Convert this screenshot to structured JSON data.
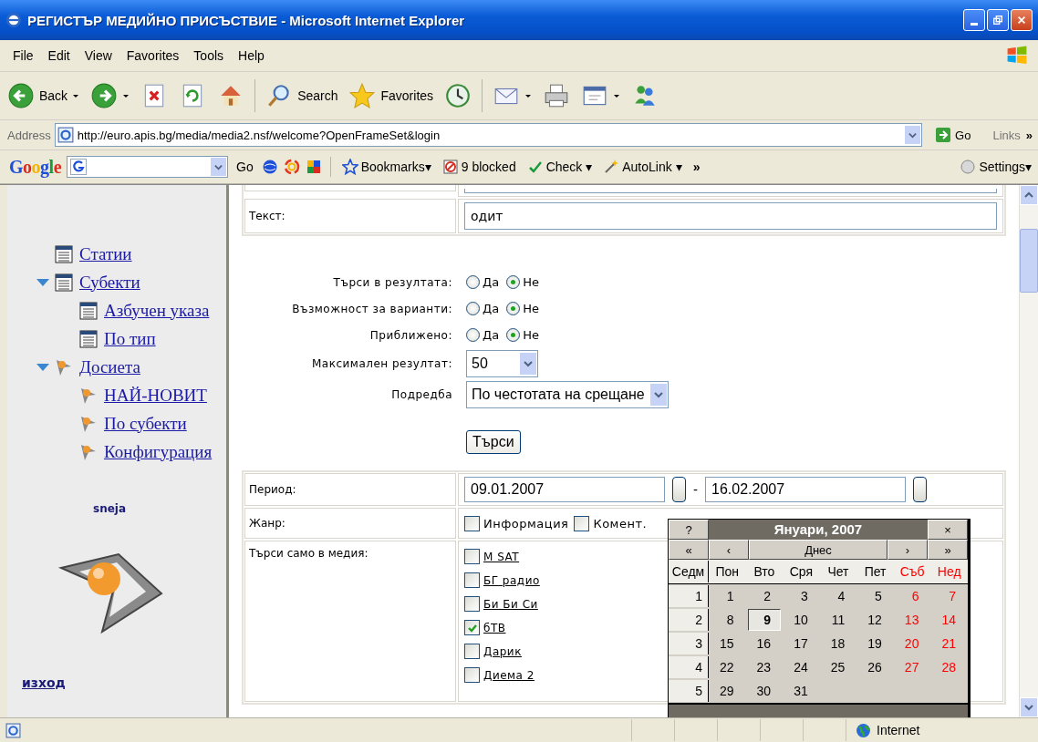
{
  "window": {
    "title": "РЕГИСТЪР МЕДИЙНО ПРИСЪСТВИЕ - Microsoft Internet Explorer"
  },
  "menu": [
    "File",
    "Edit",
    "View",
    "Favorites",
    "Tools",
    "Help"
  ],
  "toolbar": [
    {
      "kind": "back",
      "label": "Back",
      "dropdown": true
    },
    {
      "kind": "forward",
      "dropdown": true
    },
    {
      "kind": "stop"
    },
    {
      "kind": "refresh"
    },
    {
      "kind": "home"
    },
    {
      "kind": "sep"
    },
    {
      "kind": "search",
      "label": "Search"
    },
    {
      "kind": "favorites",
      "label": "Favorites"
    },
    {
      "kind": "history"
    },
    {
      "kind": "sep"
    },
    {
      "kind": "mail",
      "dropdown": true
    },
    {
      "kind": "print"
    },
    {
      "kind": "edit",
      "dropdown": true
    },
    {
      "kind": "messenger"
    }
  ],
  "address": {
    "label": "Address",
    "url": "http://euro.apis.bg/media/media2.nsf/welcome?OpenFrameSet&login",
    "go": "Go",
    "links": "Links",
    "more": "»"
  },
  "google_bar": {
    "logo": "Google",
    "go": "Go",
    "items": [
      {
        "kind": "bookmarks",
        "label": "Bookmarks▾"
      },
      {
        "kind": "blocked",
        "label": "9 blocked"
      },
      {
        "kind": "check",
        "label": "Check ▾"
      },
      {
        "kind": "autolink",
        "label": "AutoLink ▾"
      },
      {
        "kind": "more",
        "label": "»"
      }
    ],
    "settings": "Settings▾"
  },
  "sidebar": {
    "tree": [
      {
        "label": "Статии",
        "kind": "list"
      },
      {
        "label": "Субекти",
        "kind": "list",
        "expanded": true,
        "children": [
          {
            "label": "Азбучен указа",
            "kind": "list"
          },
          {
            "label": "По тип",
            "kind": "list"
          }
        ]
      },
      {
        "label": "Досиета",
        "kind": "dossier",
        "expanded": true,
        "children": [
          {
            "label": "НАЙ-НОВИТ",
            "kind": "dossier"
          },
          {
            "label": "По субекти",
            "kind": "dossier"
          },
          {
            "label": "Конфигурация",
            "kind": "dossier"
          }
        ]
      }
    ],
    "user": "sneja",
    "logout": "изход"
  },
  "form": {
    "text_field": {
      "label": "Текст:",
      "value": "одит"
    },
    "options": [
      {
        "label": "Търси в резултата:",
        "choices": [
          {
            "label": "Да",
            "selected": false
          },
          {
            "label": "Не",
            "selected": true
          }
        ]
      },
      {
        "label": "Възможност за варианти:",
        "choices": [
          {
            "label": "Да",
            "selected": false
          },
          {
            "label": "Не",
            "selected": true
          }
        ]
      },
      {
        "label": "Приближено:",
        "choices": [
          {
            "label": "Да",
            "selected": false
          },
          {
            "label": "Не",
            "selected": true
          }
        ]
      }
    ],
    "max_results": {
      "label": "Максимален резултат:",
      "value": "50"
    },
    "order": {
      "label": "Подредба",
      "value": "По честотата на срещане"
    },
    "submit": "Търси",
    "period": {
      "label": "Период:",
      "from": "09.01.2007",
      "separator": "-",
      "to": "16.02.2007"
    },
    "genre": {
      "label": "Жанр:",
      "options": [
        {
          "label": "Информация",
          "checked": false
        },
        {
          "label": "Комент.",
          "checked": false
        }
      ]
    },
    "media": {
      "label": "Търси само в медия:",
      "items": [
        {
          "label": "M SAT",
          "checked": false
        },
        {
          "label": "БГ радио",
          "checked": false
        },
        {
          "label": "Би Би Си",
          "checked": false
        },
        {
          "label": "бТВ",
          "checked": true
        },
        {
          "label": "Дарик",
          "checked": false
        },
        {
          "label": "Диема 2",
          "checked": false
        }
      ]
    }
  },
  "calendar": {
    "help": "?",
    "title": "Януари, 2007",
    "close": "×",
    "nav": [
      "«",
      "‹",
      "Днес",
      "›",
      "»"
    ],
    "week_header": "Седм",
    "weekdays": [
      {
        "label": "Пон",
        "weekend": false
      },
      {
        "label": "Вто",
        "weekend": false
      },
      {
        "label": "Сря",
        "weekend": false
      },
      {
        "label": "Чет",
        "weekend": false
      },
      {
        "label": "Пет",
        "weekend": false
      },
      {
        "label": "Съб",
        "weekend": true
      },
      {
        "label": "Нед",
        "weekend": true
      }
    ],
    "weeks": [
      {
        "number": "1",
        "days": [
          {
            "label": "1",
            "selected": false
          },
          {
            "label": "2",
            "selected": false
          },
          {
            "label": "3",
            "selected": false
          },
          {
            "label": "4",
            "selected": false
          },
          {
            "label": "5",
            "selected": false
          },
          {
            "label": "6",
            "selected": false
          },
          {
            "label": "7",
            "selected": false
          }
        ]
      },
      {
        "number": "2",
        "days": [
          {
            "label": "8",
            "selected": false
          },
          {
            "label": "9",
            "selected": true
          },
          {
            "label": "10",
            "selected": false
          },
          {
            "label": "11",
            "selected": false
          },
          {
            "label": "12",
            "selected": false
          },
          {
            "label": "13",
            "selected": false
          },
          {
            "label": "14",
            "selected": false
          }
        ]
      },
      {
        "number": "3",
        "days": [
          {
            "label": "15",
            "selected": false
          },
          {
            "label": "16",
            "selected": false
          },
          {
            "label": "17",
            "selected": false
          },
          {
            "label": "18",
            "selected": false
          },
          {
            "label": "19",
            "selected": false
          },
          {
            "label": "20",
            "selected": false
          },
          {
            "label": "21",
            "selected": false
          }
        ]
      },
      {
        "number": "4",
        "days": [
          {
            "label": "22",
            "selected": false
          },
          {
            "label": "23",
            "selected": false
          },
          {
            "label": "24",
            "selected": false
          },
          {
            "label": "25",
            "selected": false
          },
          {
            "label": "26",
            "selected": false
          },
          {
            "label": "27",
            "selected": false
          },
          {
            "label": "28",
            "selected": false
          }
        ]
      },
      {
        "number": "5",
        "days": [
          {
            "label": "29",
            "selected": false
          },
          {
            "label": "30",
            "selected": false
          },
          {
            "label": "31",
            "selected": false
          }
        ]
      }
    ]
  },
  "status_bar": {
    "zone": "Internet"
  }
}
